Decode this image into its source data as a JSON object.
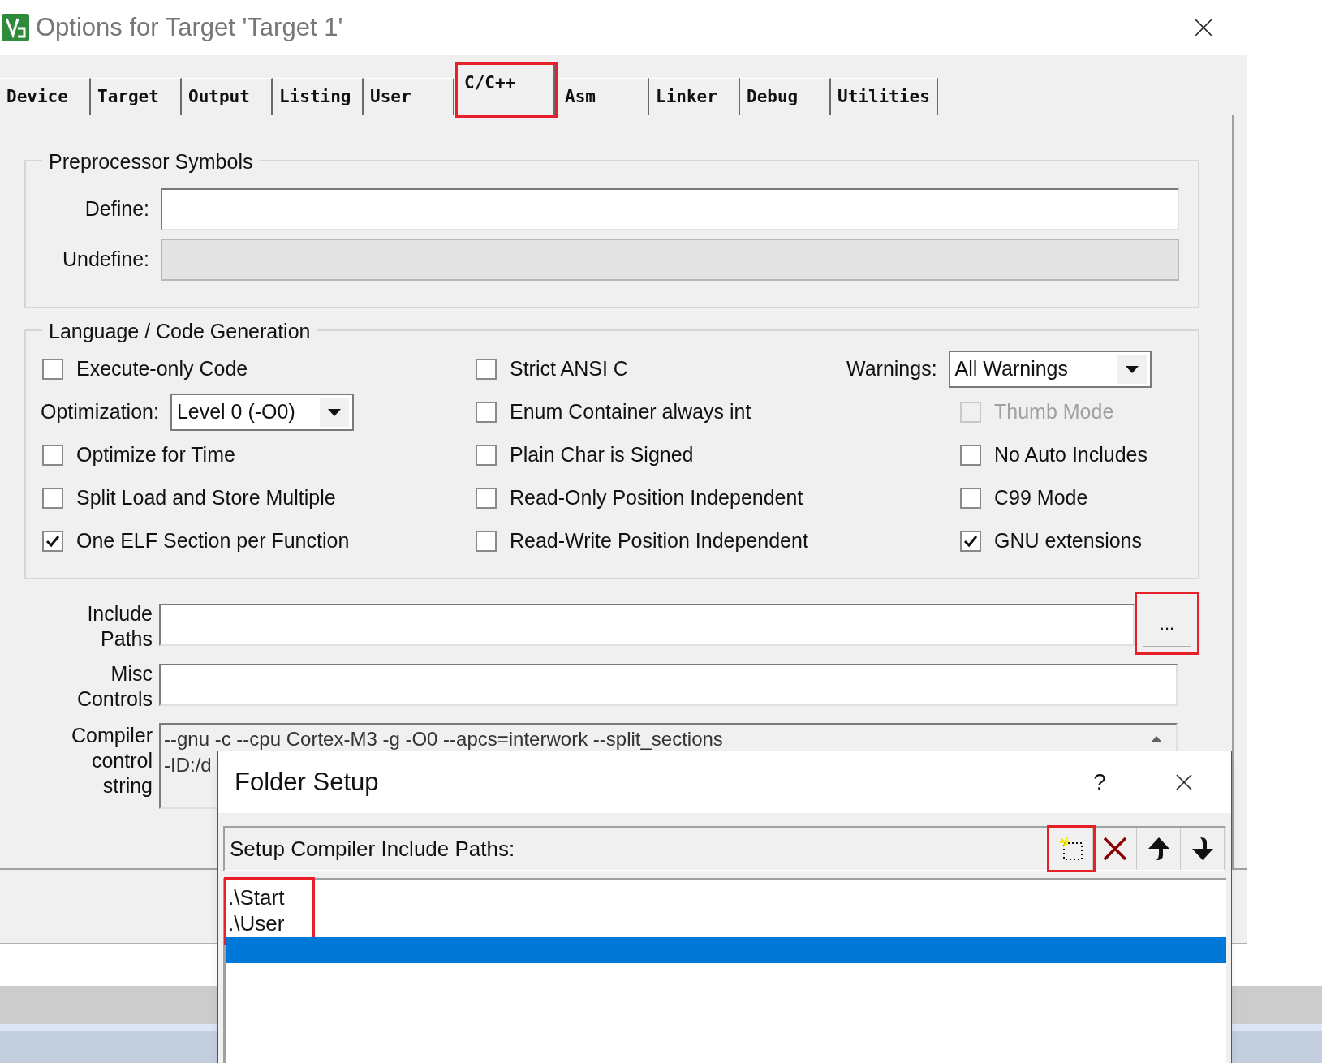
{
  "window": {
    "title": "Options for Target 'Target 1'"
  },
  "tabs": [
    {
      "label": "Device",
      "selected": false,
      "highlighted": false
    },
    {
      "label": "Target",
      "selected": false,
      "highlighted": false
    },
    {
      "label": "Output",
      "selected": false,
      "highlighted": false
    },
    {
      "label": "Listing",
      "selected": false,
      "highlighted": false
    },
    {
      "label": "User",
      "selected": false,
      "highlighted": false
    },
    {
      "label": "C/C++",
      "selected": true,
      "highlighted": true
    },
    {
      "label": "Asm",
      "selected": false,
      "highlighted": false
    },
    {
      "label": "Linker",
      "selected": false,
      "highlighted": false
    },
    {
      "label": "Debug",
      "selected": false,
      "highlighted": false
    },
    {
      "label": "Utilities",
      "selected": false,
      "highlighted": false
    }
  ],
  "preprocessor": {
    "title": "Preprocessor Symbols",
    "fields": [
      {
        "label": "Define:",
        "disabled": false
      },
      {
        "label": "Undefine:",
        "disabled": true
      }
    ]
  },
  "language": {
    "title": "Language / Code Generation",
    "columns": [
      [
        {
          "kind": "checkbox",
          "label": "Execute-only Code",
          "checked": false,
          "disabled": false
        },
        {
          "kind": "dropdown",
          "label": "Optimization:",
          "value": "Level 0 (-O0)"
        },
        {
          "kind": "checkbox",
          "label": "Optimize for Time",
          "checked": false,
          "disabled": false
        },
        {
          "kind": "checkbox",
          "label": "Split Load and Store Multiple",
          "checked": false,
          "disabled": false
        },
        {
          "kind": "checkbox",
          "label": "One ELF Section per Function",
          "checked": true,
          "disabled": false
        }
      ],
      [
        {
          "kind": "checkbox",
          "label": "Strict ANSI C",
          "checked": false,
          "disabled": false
        },
        {
          "kind": "checkbox",
          "label": "Enum Container always int",
          "checked": false,
          "disabled": false
        },
        {
          "kind": "checkbox",
          "label": "Plain Char is Signed",
          "checked": false,
          "disabled": false
        },
        {
          "kind": "checkbox",
          "label": "Read-Only Position Independent",
          "checked": false,
          "disabled": false
        },
        {
          "kind": "checkbox",
          "label": "Read-Write Position Independent",
          "checked": false,
          "disabled": false
        }
      ],
      [
        {
          "kind": "dropdown",
          "label": "Warnings:",
          "value": "All Warnings"
        },
        {
          "kind": "checkbox",
          "label": "Thumb Mode",
          "checked": false,
          "disabled": true
        },
        {
          "kind": "checkbox",
          "label": "No Auto Includes",
          "checked": false,
          "disabled": false
        },
        {
          "kind": "checkbox",
          "label": "C99 Mode",
          "checked": false,
          "disabled": false
        },
        {
          "kind": "checkbox",
          "label": "GNU extensions",
          "checked": true,
          "disabled": false
        }
      ]
    ]
  },
  "include_paths": {
    "label_lines": [
      "Include",
      "Paths"
    ],
    "browse": {
      "label": "...",
      "highlighted": true
    }
  },
  "misc_controls": {
    "label_lines": [
      "Misc",
      "Controls"
    ]
  },
  "compiler_control_string": {
    "label_lines": [
      "Compiler",
      "control",
      "string"
    ],
    "lines": [
      "--gnu -c --cpu Cortex-M3 -g -O0 --apcs=interwork --split_sections",
      "-ID:/d"
    ]
  },
  "folder_setup": {
    "title": "Folder Setup",
    "help": "?",
    "label": "Setup Compiler Include Paths:",
    "tools": [
      {
        "kind": "new",
        "highlighted": true
      },
      {
        "kind": "delete",
        "highlighted": false
      },
      {
        "kind": "up",
        "highlighted": false
      },
      {
        "kind": "down",
        "highlighted": false
      }
    ],
    "paths_highlighted": true,
    "paths": [
      {
        "text": ".\\Start",
        "selected": false
      },
      {
        "text": ".\\User",
        "selected": false
      }
    ],
    "new_entry": {
      "selected": true
    }
  }
}
